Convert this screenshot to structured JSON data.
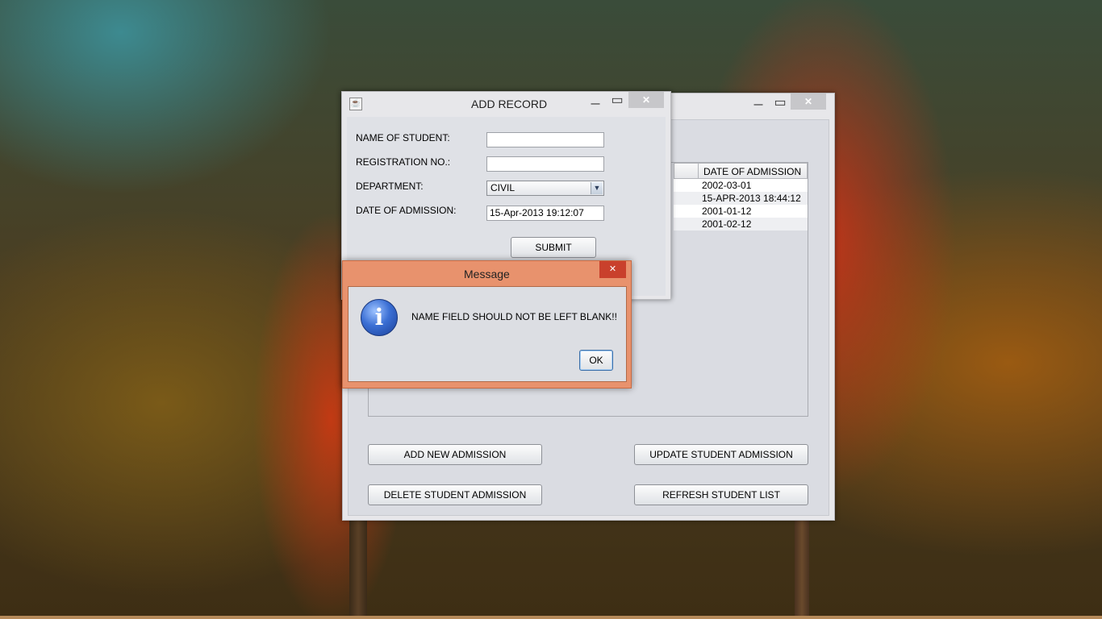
{
  "main_window": {
    "minimize_icon": "minimize-icon",
    "maximize_icon": "maximize-icon",
    "close_icon": "close-icon",
    "table": {
      "visible_header": "DATE OF ADMISSION",
      "rows": [
        "2002-03-01",
        "15-APR-2013 18:44:12",
        "2001-01-12",
        "2001-02-12"
      ]
    },
    "buttons": {
      "add": "ADD NEW ADMISSION",
      "update": "UPDATE STUDENT ADMISSION",
      "delete": "DELETE STUDENT ADMISSION",
      "refresh": "REFRESH STUDENT LIST"
    }
  },
  "add_record": {
    "title": "ADD RECORD",
    "app_icon": "java-icon",
    "labels": {
      "name": "NAME OF STUDENT:",
      "reg": "REGISTRATION NO.:",
      "dept": "DEPARTMENT:",
      "date": "DATE OF ADMISSION:"
    },
    "fields": {
      "name_value": "",
      "reg_value": "",
      "dept_value": "CIVIL",
      "date_value": "15-Apr-2013 19:12:07"
    },
    "submit_label": "SUBMIT"
  },
  "message": {
    "title": "Message",
    "text": "NAME FIELD SHOULD NOT BE LEFT BLANK!!",
    "ok_label": "OK",
    "icon": "info-icon"
  },
  "glyphs": {
    "minimize": "—",
    "maximize": "▭",
    "close": "✕",
    "info": "i",
    "java": "☕",
    "dropdown": "▼"
  },
  "colors": {
    "dialog_accent": "#e8926d",
    "close_red": "#c9402c"
  }
}
